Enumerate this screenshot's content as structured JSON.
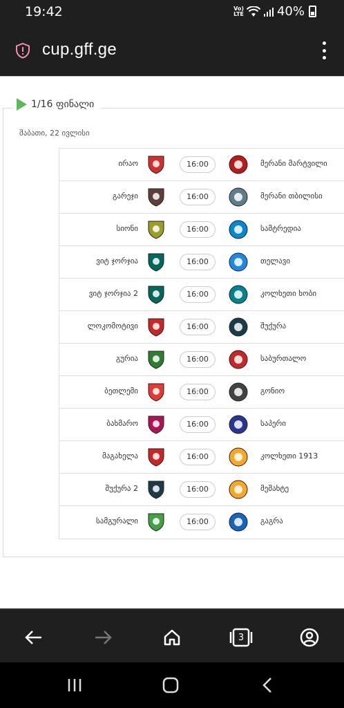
{
  "status_bar": {
    "time": "19:42",
    "network": "Vo) LTE",
    "battery": "40%"
  },
  "browser": {
    "url": "cup.gff.ge",
    "tab_count": "3"
  },
  "round": {
    "title": "1/16 ფინალი",
    "date": "შაბათი, 22 ივლისი"
  },
  "matches": [
    {
      "home": "ირაო",
      "time": "16:00",
      "away": "მერანი მარტვილი",
      "home_color": "#d32f2f",
      "away_color": "#b71c1c"
    },
    {
      "home": "გარეჯი",
      "time": "16:00",
      "away": "მერანი თბილისი",
      "home_color": "#5d4037",
      "away_color": "#607d8b"
    },
    {
      "home": "სიონი",
      "time": "16:00",
      "away": "სამტრედია",
      "home_color": "#9e9d24",
      "away_color": "#0288d1"
    },
    {
      "home": "ვიტ ჯორჯია",
      "time": "16:00",
      "away": "თელავი",
      "home_color": "#00695c",
      "away_color": "#1e88e5"
    },
    {
      "home": "ვიტ ჯორჯია 2",
      "time": "16:00",
      "away": "კოლხეთი ხობი",
      "home_color": "#00695c",
      "away_color": "#00838f"
    },
    {
      "home": "ლოკომოტივი",
      "time": "16:00",
      "away": "შუქურა",
      "home_color": "#c62828",
      "away_color": "#1b3a4b"
    },
    {
      "home": "გურია",
      "time": "16:00",
      "away": "საბურთალო",
      "home_color": "#2e7d32",
      "away_color": "#c62828"
    },
    {
      "home": "ბეთლემი",
      "time": "16:00",
      "away": "გონიო",
      "home_color": "#e53935",
      "away_color": "#424242"
    },
    {
      "home": "ბახმარო",
      "time": "16:00",
      "away": "საპერი",
      "home_color": "#ad1457",
      "away_color": "#283593"
    },
    {
      "home": "მაგახელა",
      "time": "16:00",
      "away": "კოლხეთი 1913",
      "home_color": "#c62828",
      "away_color": "#f9a825"
    },
    {
      "home": "შუქურა 2",
      "time": "16:00",
      "away": "მეშახტე",
      "home_color": "#1b3a4b",
      "away_color": "#f9a825"
    },
    {
      "home": "სამგურალი",
      "time": "16:00",
      "away": "გაგრა",
      "home_color": "#43a047",
      "away_color": "#1565c0"
    }
  ],
  "icons": {
    "shield": "shield-alert-icon",
    "menu": "more-vert-icon",
    "back": "arrow-left-icon",
    "forward": "arrow-right-icon",
    "home": "home-icon",
    "tabs": "tabs-icon",
    "account": "account-icon"
  }
}
